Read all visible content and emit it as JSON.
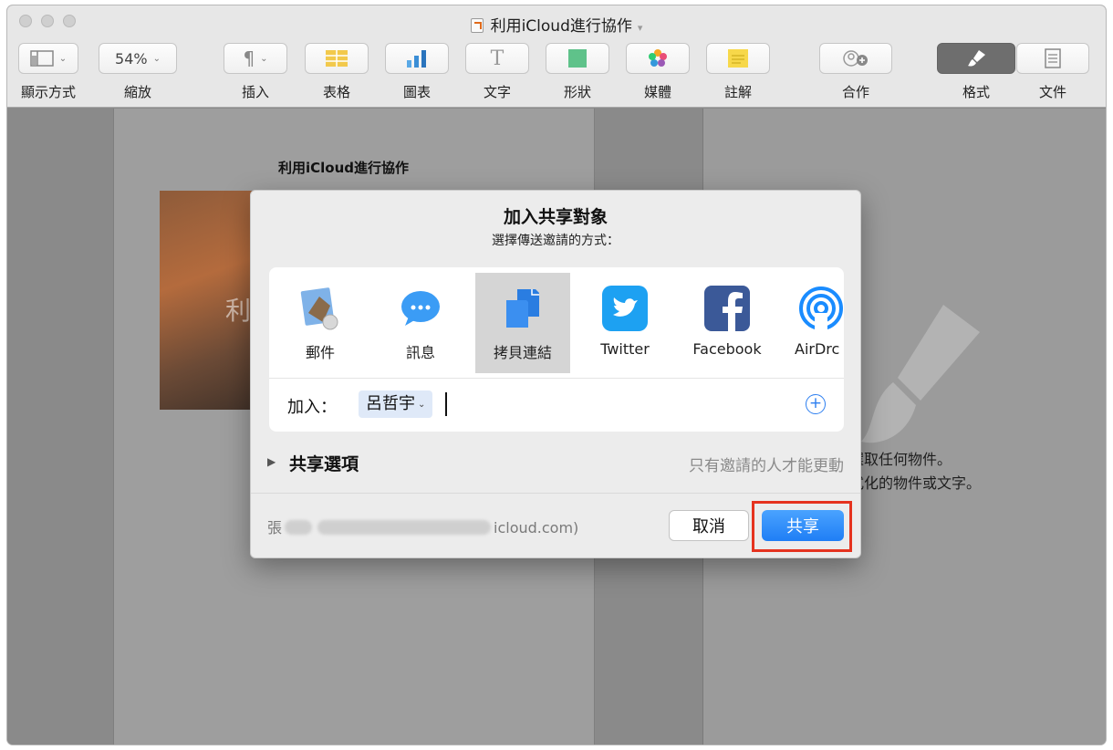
{
  "window": {
    "title": "利用iCloud進行協作"
  },
  "toolbar": {
    "items": [
      {
        "id": "view",
        "label": "顯示方式",
        "icon": "sidebar-icon"
      },
      {
        "id": "zoom",
        "label": "縮放",
        "value": "54%"
      },
      {
        "id": "insert",
        "label": "插入",
        "icon": "pilcrow-icon"
      },
      {
        "id": "table",
        "label": "表格",
        "icon": "table-icon"
      },
      {
        "id": "chart",
        "label": "圖表",
        "icon": "chart-icon"
      },
      {
        "id": "text",
        "label": "文字",
        "icon": "text-icon"
      },
      {
        "id": "shape",
        "label": "形狀",
        "icon": "shape-icon"
      },
      {
        "id": "media",
        "label": "媒體",
        "icon": "media-icon"
      },
      {
        "id": "comment",
        "label": "註解",
        "icon": "comment-icon"
      },
      {
        "id": "collaborate",
        "label": "合作",
        "icon": "collaborate-icon"
      },
      {
        "id": "format",
        "label": "格式",
        "icon": "paintbrush-icon"
      },
      {
        "id": "document",
        "label": "文件",
        "icon": "document-icon"
      }
    ]
  },
  "page": {
    "title": "利用iCloud進行協作",
    "image_text": "利"
  },
  "inspector": {
    "line1": "選取任何物件。",
    "line2": "式化的物件或文字。"
  },
  "dialog": {
    "title": "加入共享對象",
    "subtitle": "選擇傳送邀請的方式：",
    "services": [
      {
        "label": "郵件",
        "icon": "mail-icon"
      },
      {
        "label": "訊息",
        "icon": "messages-icon"
      },
      {
        "label": "拷貝連結",
        "icon": "copy-link-icon",
        "selected": true
      },
      {
        "label": "Twitter",
        "icon": "twitter-icon"
      },
      {
        "label": "Facebook",
        "icon": "facebook-icon"
      },
      {
        "label": "AirDrc",
        "icon": "airdrop-icon"
      }
    ],
    "add_label": "加入：",
    "recipient": "呂哲宇",
    "share_options_label": "共享選項",
    "permission_text": "只有邀請的人才能更動",
    "account_prefix": "張",
    "account_suffix": "icloud.com)",
    "cancel_label": "取消",
    "share_label": "共享"
  },
  "colors": {
    "accent": "#1f7ef5",
    "highlight": "#e5331f"
  }
}
